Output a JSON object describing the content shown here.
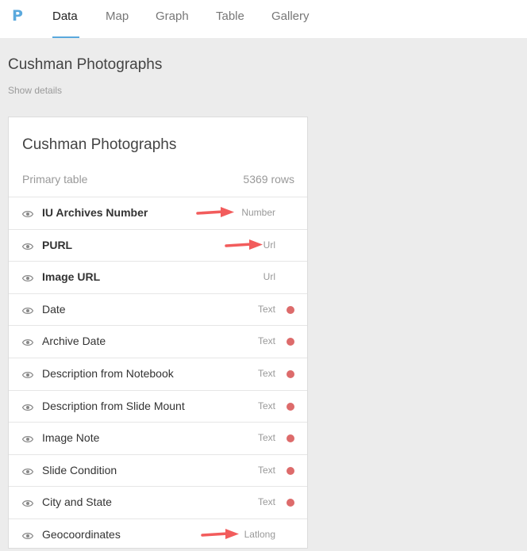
{
  "nav": {
    "logo": "P",
    "tabs": [
      {
        "label": "Data",
        "active": true
      },
      {
        "label": "Map"
      },
      {
        "label": "Graph"
      },
      {
        "label": "Table"
      },
      {
        "label": "Gallery"
      }
    ]
  },
  "page": {
    "title": "Cushman Photographs",
    "show_details": "Show details"
  },
  "card": {
    "title": "Cushman Photographs",
    "subtitle": "Primary table",
    "rows_count": "5369 rows",
    "fields": [
      {
        "name": "IU Archives Number",
        "type": "Number",
        "bold": true,
        "dot": false,
        "arrow": true
      },
      {
        "name": "PURL",
        "type": "Url",
        "bold": true,
        "dot": false,
        "arrow": true
      },
      {
        "name": "Image URL",
        "type": "Url",
        "bold": true,
        "dot": false,
        "arrow": false
      },
      {
        "name": "Date",
        "type": "Text",
        "bold": false,
        "dot": true,
        "arrow": false
      },
      {
        "name": "Archive Date",
        "type": "Text",
        "bold": false,
        "dot": true,
        "arrow": false
      },
      {
        "name": "Description from Notebook",
        "type": "Text",
        "bold": false,
        "dot": true,
        "arrow": false
      },
      {
        "name": "Description from Slide Mount",
        "type": "Text",
        "bold": false,
        "dot": true,
        "arrow": false
      },
      {
        "name": "Image Note",
        "type": "Text",
        "bold": false,
        "dot": true,
        "arrow": false
      },
      {
        "name": "Slide Condition",
        "type": "Text",
        "bold": false,
        "dot": true,
        "arrow": false
      },
      {
        "name": "City and State",
        "type": "Text",
        "bold": false,
        "dot": true,
        "arrow": false
      },
      {
        "name": "Geocoordinates",
        "type": "Latlong",
        "bold": false,
        "dot": false,
        "arrow": true
      }
    ]
  },
  "colors": {
    "accent": "#5aa9dd",
    "status_dot": "#dd6b6b",
    "annotation_arrow": "#f25c5c"
  },
  "icons": {
    "visibility": "eye-icon",
    "annotation": "arrow-icon"
  }
}
